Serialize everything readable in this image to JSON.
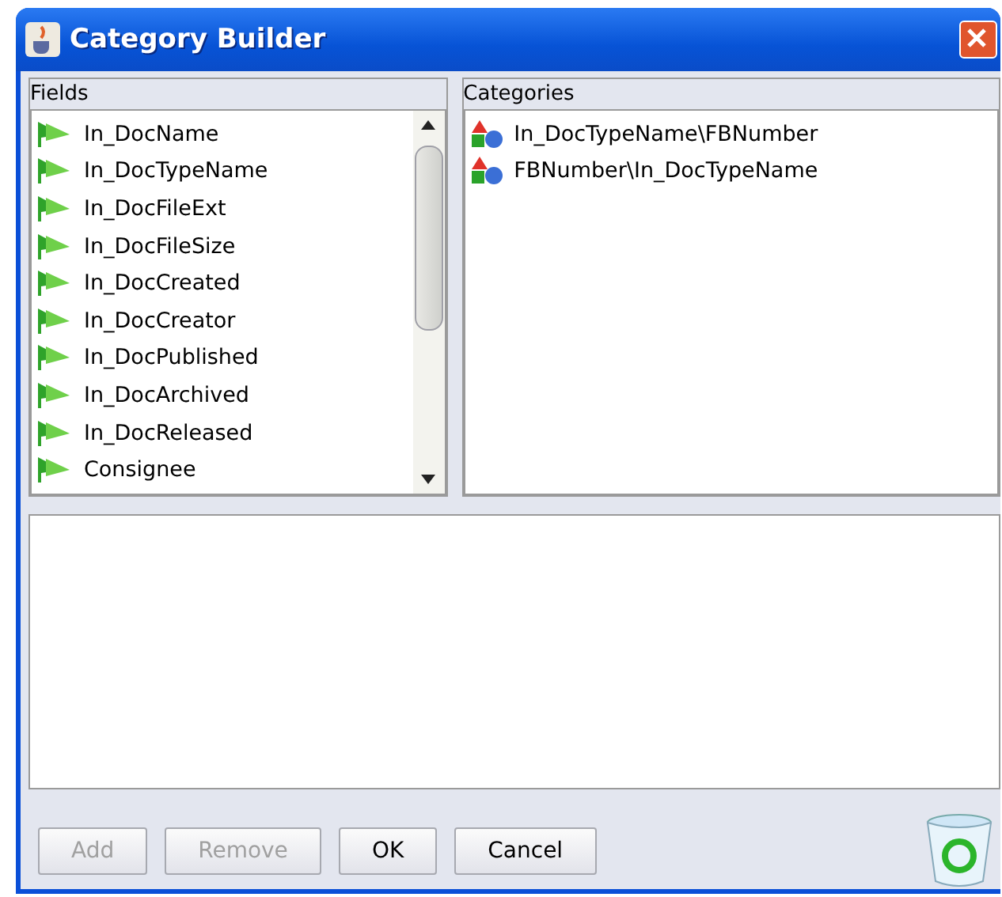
{
  "window": {
    "title": "Category Builder"
  },
  "fields": {
    "label": "Fields",
    "items": [
      "In_DocName",
      "In_DocTypeName",
      "In_DocFileExt",
      "In_DocFileSize",
      "In_DocCreated",
      "In_DocCreator",
      "In_DocPublished",
      "In_DocArchived",
      "In_DocReleased",
      "Consignee"
    ]
  },
  "categories": {
    "label": "Categories",
    "items": [
      "In_DocTypeName\\FBNumber",
      "FBNumber\\In_DocTypeName"
    ]
  },
  "buttons": [
    {
      "label": "Add",
      "disabled": true
    },
    {
      "label": "Remove",
      "disabled": true
    },
    {
      "label": "OK",
      "disabled": false
    },
    {
      "label": "Cancel",
      "disabled": false
    }
  ]
}
